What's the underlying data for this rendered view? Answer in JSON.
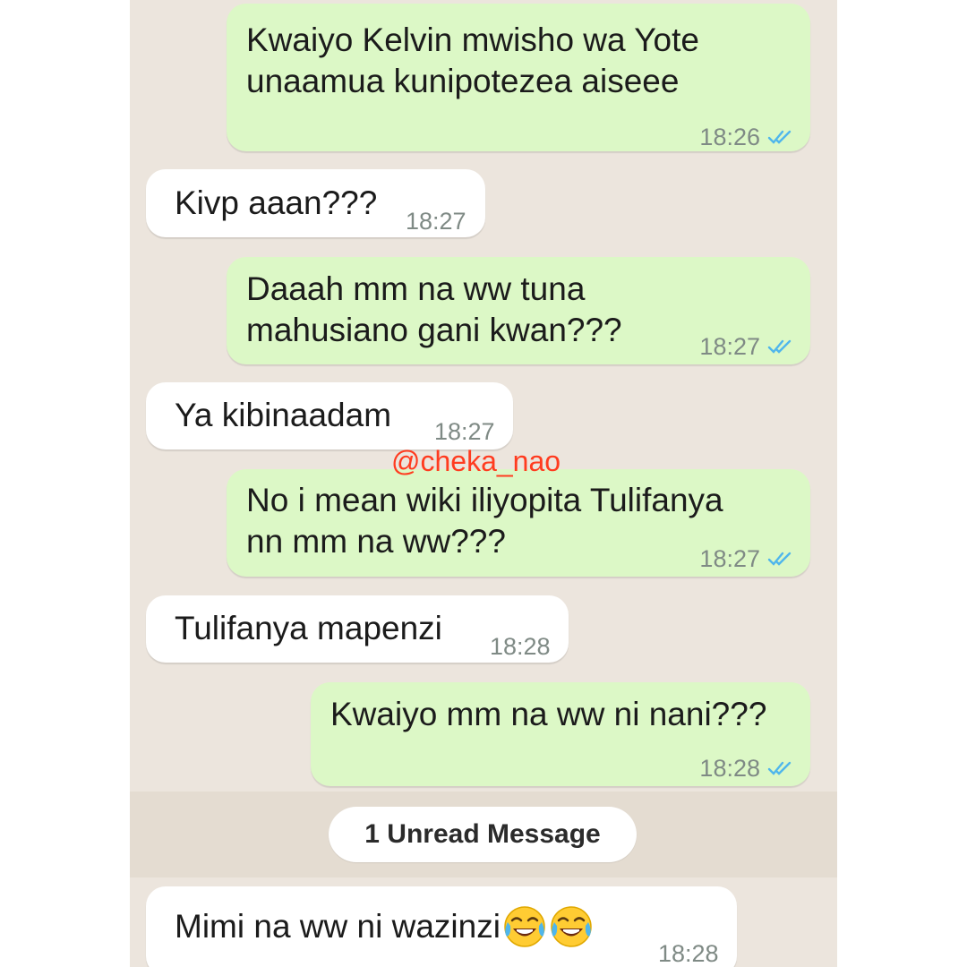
{
  "watermark": "@cheka_nao",
  "unread_divider": "1 Unread Message",
  "messages": [
    {
      "direction": "outgoing",
      "lines": [
        "Kwaiyo Kelvin mwisho wa Yote",
        "unaamua kunipotezea aiseee"
      ],
      "time": "18:26",
      "status": "read"
    },
    {
      "direction": "incoming",
      "lines": [
        "Kivp aaan???"
      ],
      "time": "18:27"
    },
    {
      "direction": "outgoing",
      "lines": [
        "Daaah mm na ww tuna",
        "mahusiano gani kwan???"
      ],
      "time": "18:27",
      "status": "read"
    },
    {
      "direction": "incoming",
      "lines": [
        "Ya kibinaadam"
      ],
      "time": "18:27"
    },
    {
      "direction": "outgoing",
      "lines": [
        "No i mean wiki iliyopita Tulifanya",
        "nn mm na ww???"
      ],
      "time": "18:27",
      "status": "read"
    },
    {
      "direction": "incoming",
      "lines": [
        "Tulifanya mapenzi"
      ],
      "time": "18:28"
    },
    {
      "direction": "outgoing",
      "lines": [
        "Kwaiyo mm na ww ni nani???"
      ],
      "time": "18:28",
      "status": "read"
    },
    {
      "direction": "incoming",
      "lines": [
        "Mimi na ww ni wazinzi"
      ],
      "emojis": [
        "face-with-tears-of-joy",
        "face-with-tears-of-joy"
      ],
      "time": "18:28"
    }
  ],
  "colors": {
    "chat_background": "#ECE5DD",
    "outgoing_bubble": "#DCF8C6",
    "incoming_bubble": "#FFFFFF",
    "read_ticks": "#4FB6EC",
    "watermark": "#FF3B1F"
  }
}
